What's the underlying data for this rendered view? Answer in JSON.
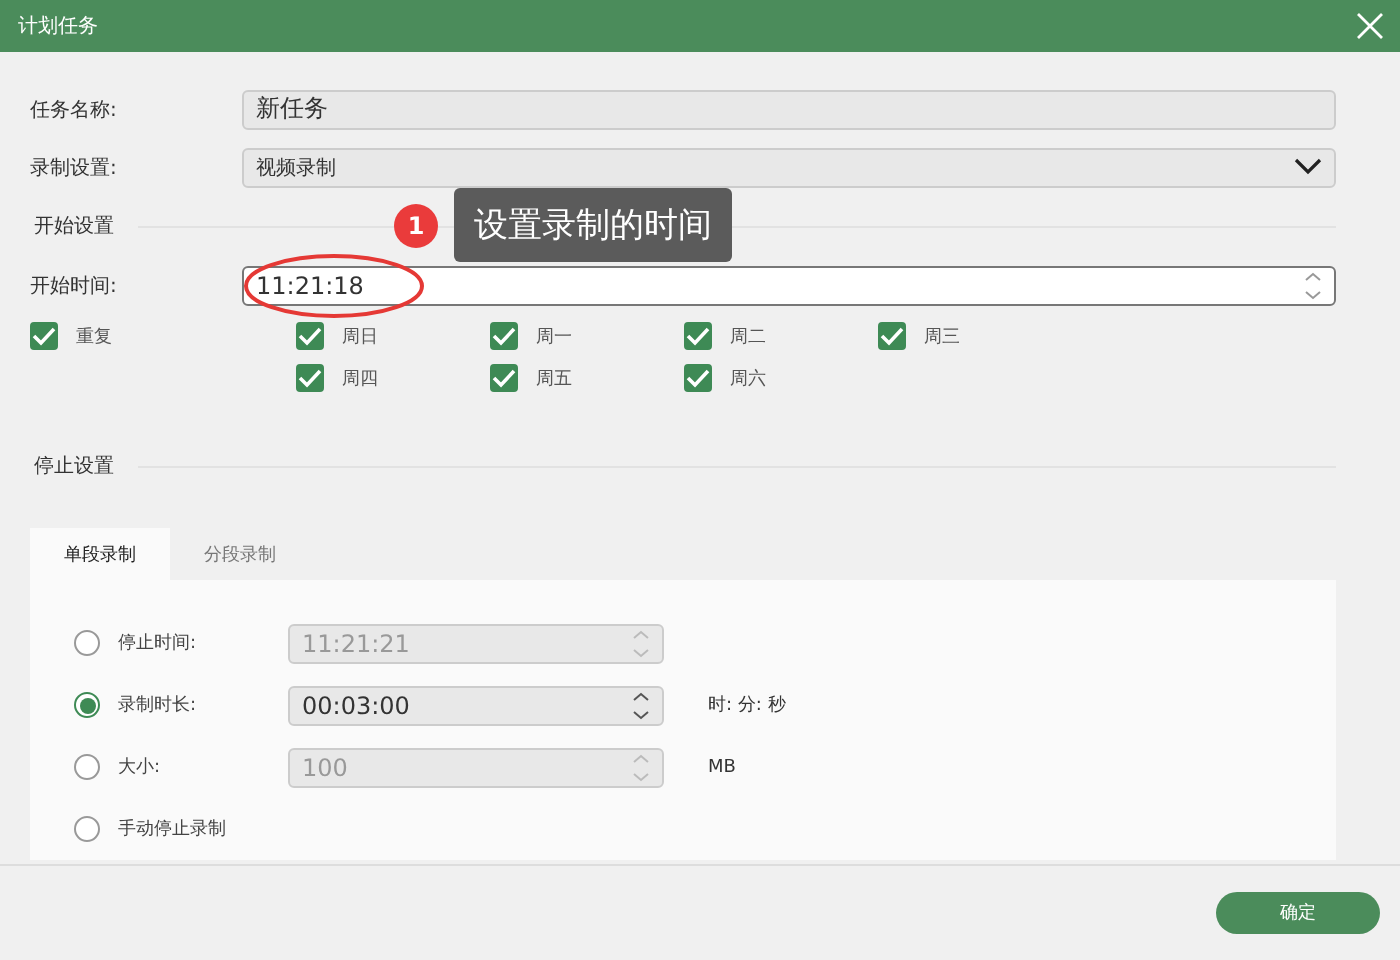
{
  "window": {
    "title": "计划任务"
  },
  "task_name": {
    "label": "任务名称:",
    "value": "新任务"
  },
  "record_setting": {
    "label": "录制设置:",
    "value": "视频录制"
  },
  "annotation": {
    "number": "1",
    "text": "设置录制的时间"
  },
  "start_section": {
    "title": "开始设置",
    "start_time": {
      "label": "开始时间:",
      "value": "11:21:18"
    },
    "repeat": {
      "label": "重复",
      "checked": true
    },
    "days": [
      {
        "label": "周日",
        "checked": true
      },
      {
        "label": "周一",
        "checked": true
      },
      {
        "label": "周二",
        "checked": true
      },
      {
        "label": "周三",
        "checked": true
      },
      {
        "label": "周四",
        "checked": true
      },
      {
        "label": "周五",
        "checked": true
      },
      {
        "label": "周六",
        "checked": true
      }
    ]
  },
  "stop_section": {
    "title": "停止设置",
    "tabs": [
      {
        "label": "单段录制",
        "selected": true
      },
      {
        "label": "分段录制",
        "selected": false
      }
    ],
    "options": [
      {
        "label": "停止时间:",
        "selected": false,
        "value": "11:21:21",
        "disabled": true
      },
      {
        "label": "录制时长:",
        "selected": true,
        "value": "00:03:00",
        "disabled": false,
        "unit": "时: 分: 秒"
      },
      {
        "label": "大小:",
        "selected": false,
        "value": "100",
        "disabled": true,
        "unit": "MB"
      },
      {
        "label": "手动停止录制",
        "selected": false
      }
    ]
  },
  "buttons": [
    {
      "label": "确定"
    }
  ]
}
